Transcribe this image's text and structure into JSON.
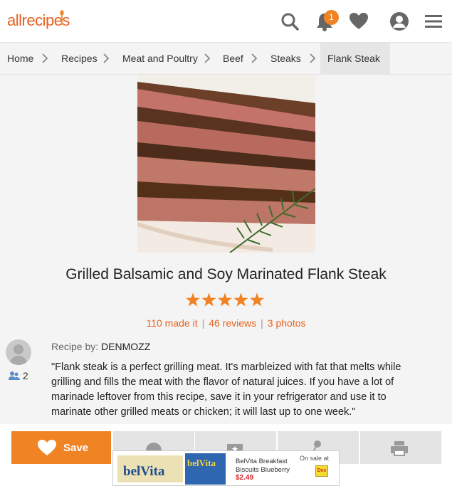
{
  "header": {
    "logo_text": "allrecipes",
    "notification_count": "1",
    "icons": [
      "search-icon",
      "bell-icon",
      "heart-icon",
      "user-icon",
      "menu-icon"
    ],
    "brand_color": "#e8611f"
  },
  "breadcrumb": {
    "items": [
      "Home",
      "Recipes",
      "Meat and Poultry",
      "Beef",
      "Steaks",
      "Flank Steak"
    ]
  },
  "recipe": {
    "title": "Grilled Balsamic and Soy Marinated Flank Steak",
    "rating": 5,
    "made_it": "110 made it",
    "reviews": "46 reviews",
    "photos": "3 photos",
    "recipe_by_label": "Recipe by:",
    "author": "DENMOZZ",
    "followers": "2",
    "description": "\"Flank steak is a perfect grilling meat. It's marbleized with fat that melts while grilling and fills the meat with the flavor of natural juices. If you have a lot of marinade leftover from this recipe, save it in your refrigerator and use it to marinate other grilled meats or chicken; it will last up to one week.\""
  },
  "actions": {
    "save_label": "Save",
    "icons": [
      "heart-icon",
      "user-icon",
      "star-icon",
      "share-icon",
      "print-icon"
    ]
  },
  "ad": {
    "brand": "belVita",
    "box_brand": "belVita",
    "product_title": "BelVita Breakfast Biscuits Blueberry",
    "price": "$2.49",
    "sale_label": "On sale at",
    "store": "Dex"
  }
}
